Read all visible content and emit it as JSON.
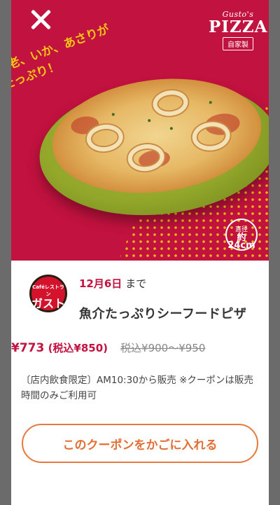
{
  "hero": {
    "brand_sub": "Gusto's",
    "brand_main": "PIZZA",
    "brand_tag": "自家製",
    "catchphrase": "海老、いか、あさりがたっぷり！",
    "size_label": "直径",
    "size_value": "約24cm"
  },
  "store": {
    "logo_top": "Caféレストラン",
    "logo_name": "ガスト"
  },
  "coupon": {
    "deadline_date": "12月6日",
    "deadline_suffix": "まで",
    "title": "魚介たっぷりシーフードピザ",
    "price_now": "¥773",
    "price_now_tax": "(税込¥850)",
    "price_old": "税込¥900〜¥950",
    "note": "〔店内飲食限定〕AM10:30から販売 ※クーポンは販売時間のみご利用可",
    "cart_button": "このクーポンをかごに入れる"
  },
  "colors": {
    "hero_bg": "#c2123f",
    "accent": "#c2123f",
    "button_border": "#e8793c"
  },
  "icons": {
    "close": "close-icon"
  }
}
